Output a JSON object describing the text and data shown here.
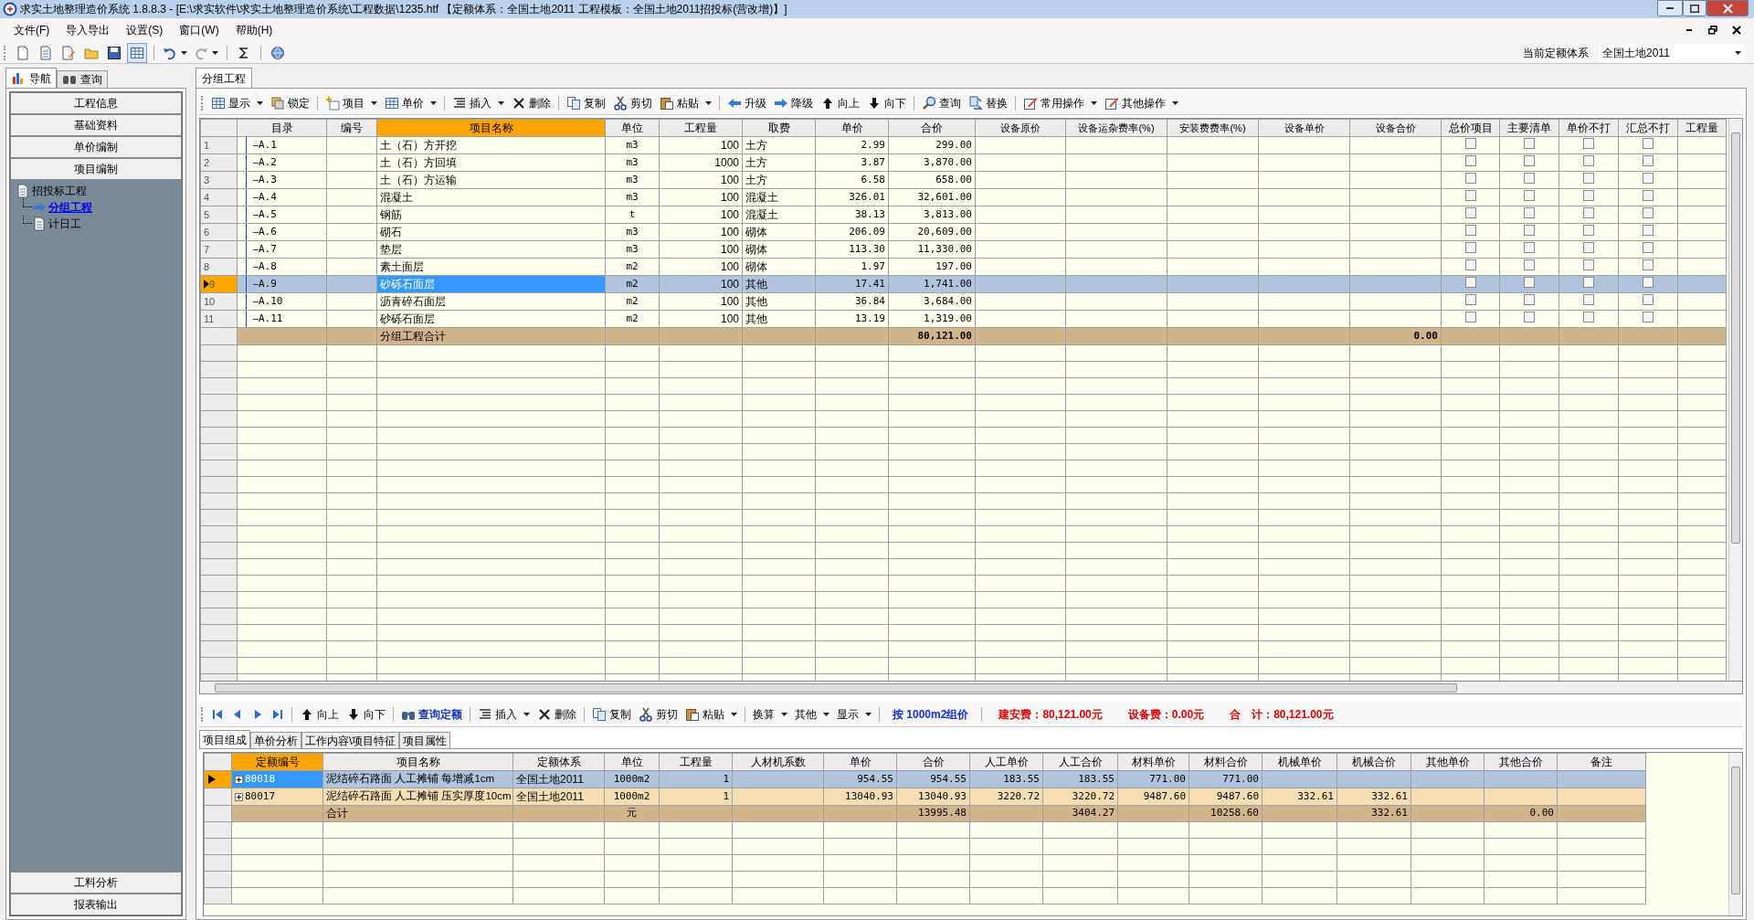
{
  "window": {
    "title": "求实土地整理造价系统 1.8.8.3 - [E:\\求实软件\\求实土地整理造价系统\\工程数据\\1235.htf 【定额体系：全国土地2011  工程模板：全国土地2011招投标(营改增)】]"
  },
  "menu": [
    "文件(F)",
    "导入导出",
    "设置(S)",
    "窗口(W)",
    "帮助(H)"
  ],
  "quota_system": {
    "label": "当前定额体系",
    "value": "全国土地2011"
  },
  "nav_tabs": [
    {
      "label": "导航",
      "selected": true
    },
    {
      "label": "查询",
      "selected": false
    }
  ],
  "nav_buttons": [
    "工程信息",
    "基础资料",
    "单价编制",
    "项目编制"
  ],
  "tree": [
    {
      "label": "招投标工程",
      "selected": false,
      "children": [
        {
          "label": "分组工程",
          "selected": true
        },
        {
          "label": "计日工",
          "selected": false
        }
      ]
    }
  ],
  "nav_bottom": [
    "工料分析",
    "报表输出"
  ],
  "doc_tab": "分组工程",
  "toolbar": [
    [
      {
        "label": "显示",
        "dropdown": true
      },
      {
        "label": "锁定",
        "dropdown": false
      }
    ],
    [
      {
        "label": "项目",
        "dropdown": true
      },
      {
        "label": "单价",
        "dropdown": true
      }
    ],
    [
      {
        "label": "插入",
        "dropdown": true
      },
      {
        "label": "删除",
        "dropdown": false
      }
    ],
    [
      {
        "label": "复制",
        "dropdown": false
      },
      {
        "label": "剪切",
        "dropdown": false
      },
      {
        "label": "粘贴",
        "dropdown": true
      }
    ],
    [
      {
        "label": "升级",
        "dropdown": false
      },
      {
        "label": "降级",
        "dropdown": false
      },
      {
        "label": "向上",
        "dropdown": false
      },
      {
        "label": "向下",
        "dropdown": false
      }
    ],
    [
      {
        "label": "查询",
        "dropdown": false
      },
      {
        "label": "替换",
        "dropdown": false
      }
    ],
    [
      {
        "label": "常用操作",
        "dropdown": true
      },
      {
        "label": "其他操作",
        "dropdown": true
      }
    ]
  ],
  "table": {
    "columns": [
      {
        "label": "目录",
        "highlighted": false
      },
      {
        "label": "编号",
        "highlighted": false
      },
      {
        "label": "项目名称",
        "highlighted": true
      },
      {
        "label": "单位",
        "highlighted": false
      },
      {
        "label": "工程量",
        "highlighted": false
      },
      {
        "label": "取费",
        "highlighted": false
      },
      {
        "label": "单价",
        "highlighted": false
      },
      {
        "label": "合价",
        "highlighted": false
      },
      {
        "label": "设备原价",
        "highlighted": false
      },
      {
        "label": "设备运杂费率(%)",
        "highlighted": false
      },
      {
        "label": "安装费费率(%)",
        "highlighted": false
      },
      {
        "label": "设备单价",
        "highlighted": false
      },
      {
        "label": "设备合价",
        "highlighted": false
      },
      {
        "label": "总价项目",
        "highlighted": false
      },
      {
        "label": "主要清单",
        "highlighted": false
      },
      {
        "label": "单价不打",
        "highlighted": false
      },
      {
        "label": "汇总不打",
        "highlighted": false
      },
      {
        "label": "工程量",
        "highlighted": false
      }
    ],
    "rows": [
      {
        "kind": "item",
        "num": "1",
        "selected": false,
        "cells": [
          "A.1",
          null,
          "土（石）方开挖",
          "m3",
          "100",
          "土方",
          "2.99",
          "299.00",
          null,
          null,
          null,
          null,
          null
        ],
        "checks": [
          false,
          false,
          false,
          false
        ]
      },
      {
        "kind": "item",
        "num": "2",
        "selected": false,
        "cells": [
          "A.2",
          null,
          "土（石）方回填",
          "m3",
          "1000",
          "土方",
          "3.87",
          "3,870.00",
          null,
          null,
          null,
          null,
          null
        ],
        "checks": [
          false,
          false,
          false,
          false
        ]
      },
      {
        "kind": "item",
        "num": "3",
        "selected": false,
        "cells": [
          "A.3",
          null,
          "土（石）方运输",
          "m3",
          "100",
          "土方",
          "6.58",
          "658.00",
          null,
          null,
          null,
          null,
          null
        ],
        "checks": [
          false,
          false,
          false,
          false
        ]
      },
      {
        "kind": "item",
        "num": "4",
        "selected": false,
        "cells": [
          "A.4",
          null,
          "混凝土",
          "m3",
          "100",
          "混凝土",
          "326.01",
          "32,601.00",
          null,
          null,
          null,
          null,
          null
        ],
        "checks": [
          false,
          false,
          false,
          false
        ]
      },
      {
        "kind": "item",
        "num": "5",
        "selected": false,
        "cells": [
          "A.5",
          null,
          "钢筋",
          "t",
          "100",
          "混凝土",
          "38.13",
          "3,813.00",
          null,
          null,
          null,
          null,
          null
        ],
        "checks": [
          false,
          false,
          false,
          false
        ]
      },
      {
        "kind": "item",
        "num": "6",
        "selected": false,
        "cells": [
          "A.6",
          null,
          "砌石",
          "m3",
          "100",
          "砌体",
          "206.09",
          "20,609.00",
          null,
          null,
          null,
          null,
          null
        ],
        "checks": [
          false,
          false,
          false,
          false
        ]
      },
      {
        "kind": "item",
        "num": "7",
        "selected": false,
        "cells": [
          "A.7",
          null,
          "垫层",
          "m3",
          "100",
          "砌体",
          "113.30",
          "11,330.00",
          null,
          null,
          null,
          null,
          null
        ],
        "checks": [
          false,
          false,
          false,
          false
        ]
      },
      {
        "kind": "item",
        "num": "8",
        "selected": false,
        "cells": [
          "A.8",
          null,
          "素土面层",
          "m2",
          "100",
          "砌体",
          "1.97",
          "197.00",
          null,
          null,
          null,
          null,
          null
        ],
        "checks": [
          false,
          false,
          false,
          false
        ]
      },
      {
        "kind": "item",
        "num": "9",
        "selected": true,
        "cells": [
          "A.9",
          null,
          "砂砾石面层",
          "m2",
          "100",
          "其他",
          "17.41",
          "1,741.00",
          null,
          null,
          null,
          null,
          null
        ],
        "checks": [
          false,
          false,
          false,
          false
        ]
      },
      {
        "kind": "item",
        "num": "10",
        "selected": false,
        "cells": [
          "A.10",
          null,
          "沥青碎石面层",
          "m2",
          "100",
          "其他",
          "36.84",
          "3,684.00",
          null,
          null,
          null,
          null,
          null
        ],
        "checks": [
          false,
          false,
          false,
          false
        ]
      },
      {
        "kind": "item",
        "num": "11",
        "selected": false,
        "cells": [
          "A.11",
          null,
          "砂砾石面层",
          "m2",
          "100",
          "其他",
          "13.19",
          "1,319.00",
          null,
          null,
          null,
          null,
          null
        ],
        "checks": [
          false,
          false,
          false,
          false
        ]
      },
      {
        "kind": "total",
        "cells": [
          null,
          null,
          "分组工程合计",
          null,
          null,
          null,
          null,
          "80,121.00",
          null,
          null,
          null,
          null,
          "0.00"
        ]
      }
    ]
  },
  "lower_toolbar": {
    "groups": [
      [
        {
          "label": "向上",
          "dropdown": false
        },
        {
          "label": "向下",
          "dropdown": false
        }
      ],
      [
        {
          "label": "查询定额",
          "dropdown": false
        }
      ],
      [
        {
          "label": "插入",
          "dropdown": true
        },
        {
          "label": "删除",
          "dropdown": false
        }
      ],
      [
        {
          "label": "复制",
          "dropdown": false
        },
        {
          "label": "剪切",
          "dropdown": false
        },
        {
          "label": "粘贴",
          "dropdown": true
        }
      ],
      [
        {
          "label": "换算",
          "dropdown": true
        },
        {
          "label": "其他",
          "dropdown": true
        },
        {
          "label": "显示",
          "dropdown": true
        }
      ]
    ],
    "pricing_mode": "按 1000m2组价",
    "summaries": [
      "建安费：80,121.00元",
      "设备费：0.00元",
      "合　计：80,121.00元"
    ]
  },
  "lower_tabs": [
    {
      "label": "项目组成",
      "selected": true
    },
    {
      "label": "单价分析",
      "selected": false
    },
    {
      "label": "工作内容\\项目特征",
      "selected": false
    },
    {
      "label": "项目属性",
      "selected": false
    }
  ],
  "lower_table": {
    "columns": [
      {
        "label": "定额编号",
        "highlighted": true
      },
      {
        "label": "项目名称",
        "highlighted": false
      },
      {
        "label": "定额体系",
        "highlighted": false
      },
      {
        "label": "单位",
        "highlighted": false
      },
      {
        "label": "工程量",
        "highlighted": false
      },
      {
        "label": "人材机系数",
        "highlighted": false
      },
      {
        "label": "单价",
        "highlighted": false
      },
      {
        "label": "合价",
        "highlighted": false
      },
      {
        "label": "人工单价",
        "highlighted": false
      },
      {
        "label": "人工合价",
        "highlighted": false
      },
      {
        "label": "材料单价",
        "highlighted": false
      },
      {
        "label": "材料合价",
        "highlighted": false
      },
      {
        "label": "机械单价",
        "highlighted": false
      },
      {
        "label": "机械合价",
        "highlighted": false
      },
      {
        "label": "其他单价",
        "highlighted": false
      },
      {
        "label": "其他合价",
        "highlighted": false
      },
      {
        "label": "备注",
        "highlighted": false
      }
    ],
    "rows": [
      {
        "kind": "item",
        "selected": true,
        "cells": [
          "80018",
          "泥结碎石路面 人工摊铺 每增减1cm",
          "全国土地2011",
          "1000m2",
          "1",
          null,
          "954.55",
          "954.55",
          "183.55",
          "183.55",
          "771.00",
          "771.00",
          null,
          null,
          null,
          null,
          null
        ]
      },
      {
        "kind": "item",
        "selected": false,
        "cells": [
          "80017",
          "泥结碎石路面 人工摊铺 压实厚度10cm",
          "全国土地2011",
          "1000m2",
          "1",
          null,
          "13040.93",
          "13040.93",
          "3220.72",
          "3220.72",
          "9487.60",
          "9487.60",
          "332.61",
          "332.61",
          null,
          null,
          null
        ]
      },
      {
        "kind": "total",
        "cells": [
          null,
          "合计",
          null,
          "元",
          null,
          null,
          null,
          "13995.48",
          null,
          "3404.27",
          null,
          "10258.60",
          null,
          "332.61",
          null,
          "0.00",
          null
        ]
      }
    ]
  }
}
